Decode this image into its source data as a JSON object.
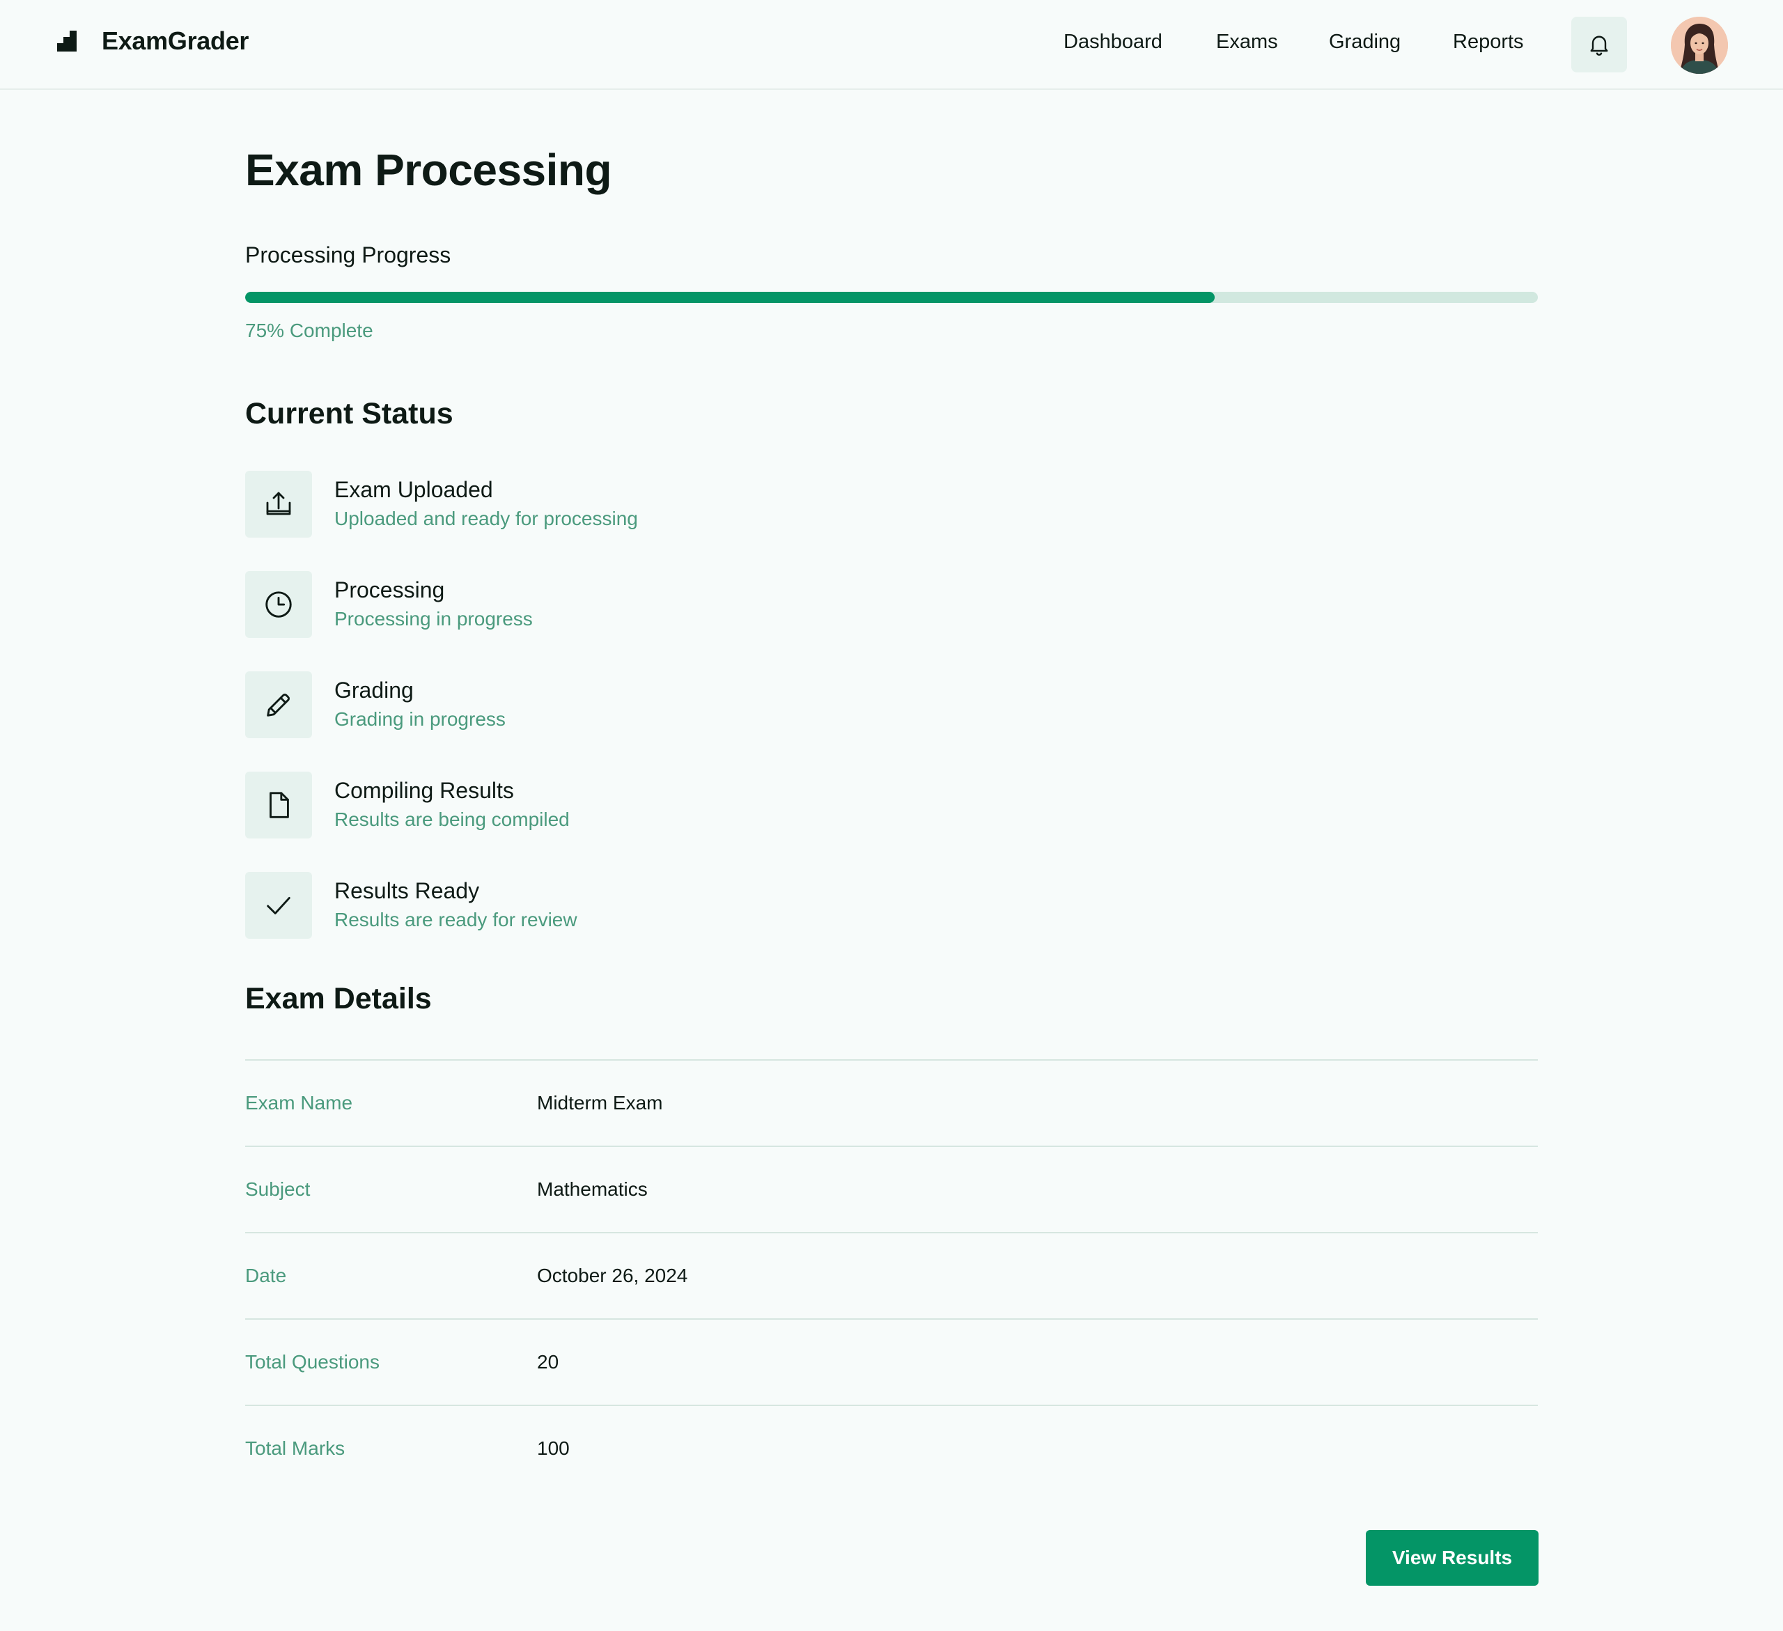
{
  "app": {
    "name": "ExamGrader"
  },
  "nav": {
    "items": [
      {
        "label": "Dashboard"
      },
      {
        "label": "Exams"
      },
      {
        "label": "Grading"
      },
      {
        "label": "Reports"
      }
    ],
    "notifications_icon": "bell-icon",
    "avatar_icon": "user-avatar"
  },
  "page": {
    "title": "Exam Processing"
  },
  "progress": {
    "label": "Processing Progress",
    "percent": 75,
    "text": "75% Complete"
  },
  "status": {
    "title": "Current Status",
    "items": [
      {
        "icon": "upload-icon",
        "title": "Exam Uploaded",
        "desc": "Uploaded and ready for processing"
      },
      {
        "icon": "clock-icon",
        "title": "Processing",
        "desc": "Processing in progress"
      },
      {
        "icon": "pencil-icon",
        "title": "Grading",
        "desc": "Grading in progress"
      },
      {
        "icon": "document-icon",
        "title": "Compiling Results",
        "desc": "Results are being compiled"
      },
      {
        "icon": "check-icon",
        "title": "Results Ready",
        "desc": "Results are ready for review"
      }
    ]
  },
  "details": {
    "title": "Exam Details",
    "rows": [
      {
        "key": "Exam Name",
        "value": "Midterm Exam"
      },
      {
        "key": "Subject",
        "value": "Mathematics"
      },
      {
        "key": "Date",
        "value": "October 26, 2024"
      },
      {
        "key": "Total Questions",
        "value": "20"
      },
      {
        "key": "Total Marks",
        "value": "100"
      }
    ]
  },
  "actions": {
    "view_results": "View Results"
  },
  "colors": {
    "accent": "#049566",
    "muted_text": "#4a9a7d",
    "icon_bg": "#e6f2ee",
    "track": "#d1e8df",
    "background": "#f7fbfa"
  }
}
